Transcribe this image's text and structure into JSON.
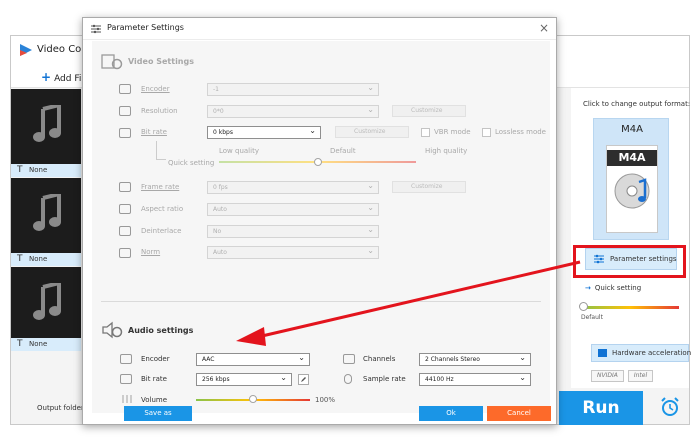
{
  "main": {
    "title": "Video Conv",
    "add_files": "Add File",
    "items": [
      {
        "subtitle": "None"
      },
      {
        "subtitle": "None"
      },
      {
        "subtitle": "None"
      }
    ],
    "output_folder_label": "Output folder:",
    "run_label": "Run"
  },
  "right_pane": {
    "output_format_hint": "Click to change output format:",
    "format_name": "M4A",
    "format_badge": "M4A",
    "parameter_settings": "Parameter settings",
    "quick_setting": "Quick setting",
    "default_label": "Default",
    "hardware_acceleration": "Hardware acceleration",
    "chips": [
      "NVIDIA",
      "Intel"
    ]
  },
  "dialog": {
    "title": "Parameter Settings",
    "video": {
      "section_title": "Video Settings",
      "encoder_label": "Encoder",
      "encoder_value": "-1",
      "resolution_label": "Resolution",
      "resolution_value": "0*0",
      "customize": "Customize",
      "bitrate_label": "Bit rate",
      "bitrate_value": "0 kbps",
      "vbr_mode": "VBR mode",
      "lossless_mode": "Lossless mode",
      "quick_setting": "Quick setting",
      "low_quality": "Low quality",
      "default": "Default",
      "high_quality": "High quality",
      "quality_level": 0.5,
      "framerate_label": "Frame rate",
      "framerate_value": "0 fps",
      "aspect_label": "Aspect ratio",
      "aspect_value": "Auto",
      "deinterlace_label": "Deinterlace",
      "deinterlace_value": "No",
      "norm_label": "Norm",
      "norm_value": "Auto"
    },
    "audio": {
      "section_title": "Audio settings",
      "encoder_label": "Encoder",
      "encoder_value": "AAC",
      "channels_label": "Channels",
      "channels_value": "2 Channels Stereo",
      "bitrate_label": "Bit rate",
      "bitrate_value": "256 kbps",
      "samplerate_label": "Sample rate",
      "samplerate_value": "44100 Hz",
      "volume_label": "Volume",
      "volume_value": "100%",
      "volume_level": 0.5
    },
    "save_as": "Save as",
    "ok": "Ok",
    "cancel": "Cancel"
  },
  "colors": {
    "accent": "#1a95e6",
    "highlight": "#e3141d",
    "cancel": "#fd6a2a"
  }
}
